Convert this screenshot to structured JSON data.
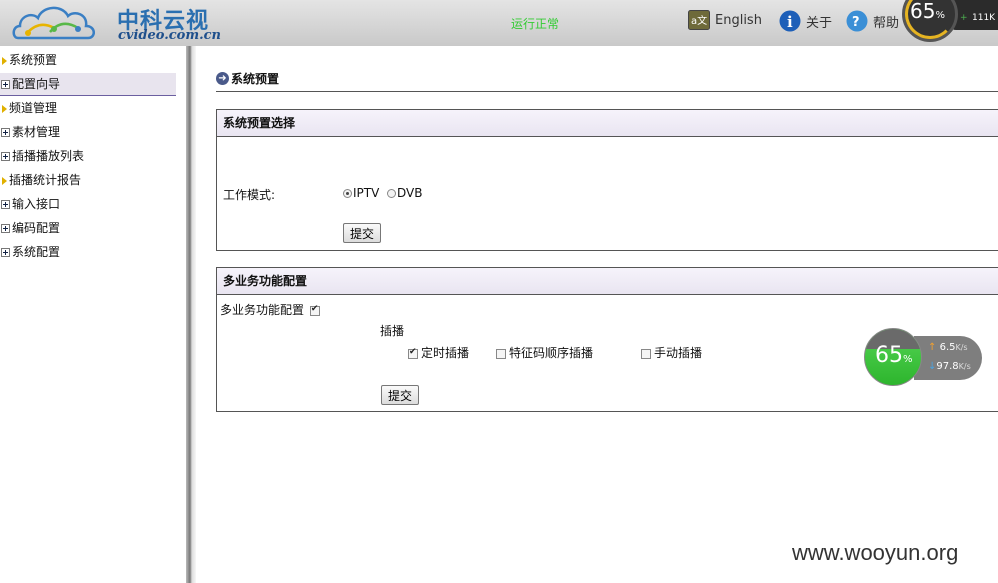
{
  "header": {
    "brand_cn": "中科云视",
    "brand_en": "cvideo.com.cn",
    "status": "运行正常",
    "english_label": "English",
    "about_label": "关于",
    "help_label": "帮助",
    "monitor_percent": "65",
    "monitor_percent_sign": "%",
    "monitor_speed": "111K"
  },
  "sidebar": {
    "items": [
      {
        "label": "系统预置"
      },
      {
        "label": "配置向导"
      },
      {
        "label": "频道管理"
      },
      {
        "label": "素材管理"
      },
      {
        "label": "插播播放列表"
      },
      {
        "label": "插播统计报告"
      },
      {
        "label": "输入接口"
      },
      {
        "label": "编码配置"
      },
      {
        "label": "系统配置"
      }
    ]
  },
  "main": {
    "page_title": "系统预置",
    "preset_panel": {
      "title": "系统预置选择",
      "mode_label": "工作模式:",
      "options": [
        "IPTV",
        "DVB"
      ],
      "selected": "IPTV",
      "submit_label": "提交"
    },
    "multi_panel": {
      "title": "多业务功能配置",
      "enable_label": "多业务功能配置",
      "enable_checked": true,
      "group_label": "插播",
      "options": [
        {
          "label": "定时插播",
          "checked": true
        },
        {
          "label": "特征码顺序插播",
          "checked": false
        },
        {
          "label": "手动插播",
          "checked": false
        }
      ],
      "submit_label": "提交"
    }
  },
  "overlay": {
    "percent": "65",
    "percent_sign": "%",
    "upload": "6.5",
    "download": "97.8",
    "unit": "K/s"
  },
  "watermark": "www.wooyun.org"
}
